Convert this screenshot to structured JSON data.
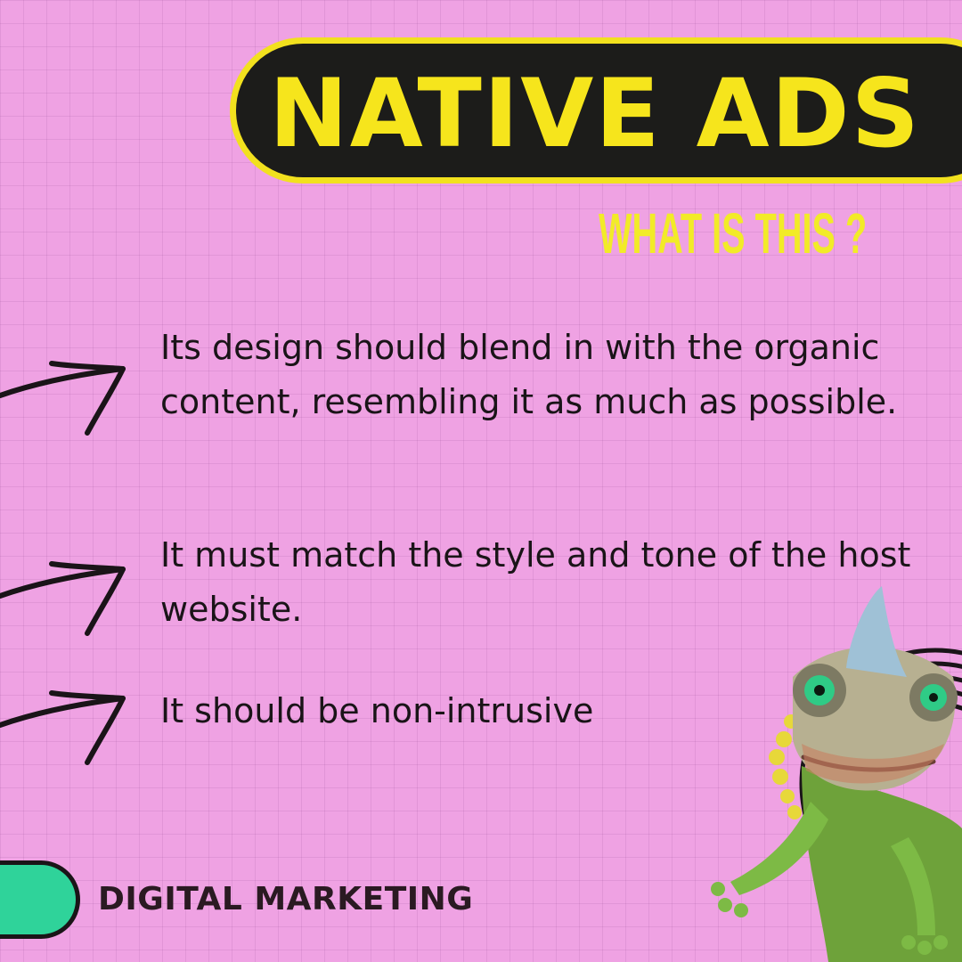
{
  "header": {
    "title": "NATIVE ADS",
    "subtitle": "WHAT IS THIS ?"
  },
  "points": [
    {
      "text": "Its design should blend in with the organic content, resembling it as much as possible."
    },
    {
      "text": "It must match the style and tone of the host website."
    },
    {
      "text": "It should be non-intrusive"
    }
  ],
  "footer": {
    "label": "DIGITAL MARKETING"
  },
  "icons": {
    "arrow": "hand-drawn-arrow-icon",
    "mascot": "chameleon-illustration"
  },
  "colors": {
    "background": "#EFA2E3",
    "title_pill": "#1C1C1A",
    "title_accent": "#F6E51C",
    "footer_pill": "#2FD39A",
    "text": "#1A1418"
  }
}
